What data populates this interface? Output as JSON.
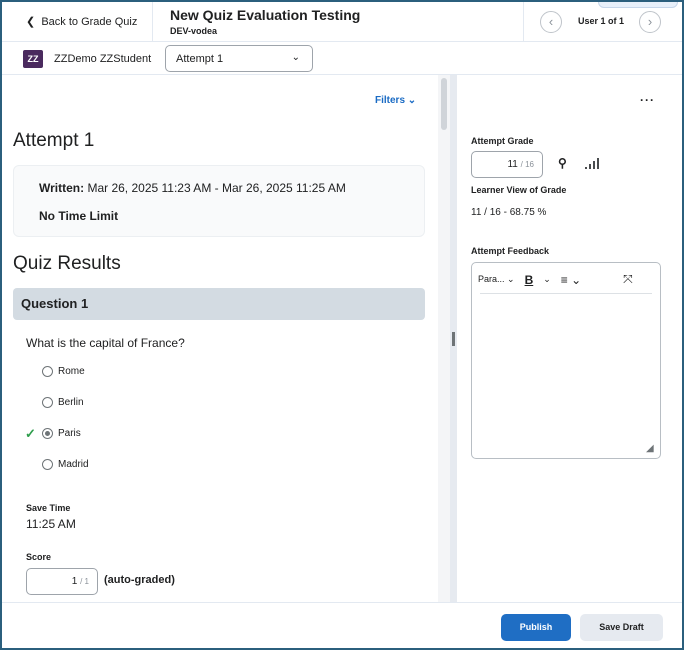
{
  "header": {
    "back_label": "Back to Grade Quiz",
    "title": "New Quiz Evaluation Testing",
    "subtitle": "DEV-vodea",
    "user_counter": "User 1 of 1",
    "prev_icon": "chevron-left",
    "next_icon": "chevron-right"
  },
  "student": {
    "initials": "ZZ",
    "name": "ZZDemo ZZStudent",
    "attempt_select": "Attempt 1"
  },
  "main": {
    "filters_label": "Filters",
    "attempt_heading": "Attempt 1",
    "written_label": "Written:",
    "written_value": "Mar 26, 2025 11:23 AM - Mar 26, 2025 11:25 AM",
    "time_limit": "No Time Limit",
    "results_heading": "Quiz Results",
    "question": {
      "title": "Question 1",
      "text": "What is the capital of France?",
      "options": [
        {
          "label": "Rome",
          "selected": false
        },
        {
          "label": "Berlin",
          "selected": false
        },
        {
          "label": "Paris",
          "selected": true,
          "correct": true
        },
        {
          "label": "Madrid",
          "selected": false
        }
      ]
    },
    "save_time_label": "Save Time",
    "save_time_value": "11:25 AM",
    "score_label": "Score",
    "score_value": "1",
    "score_max": "/ 1",
    "auto_graded": "(auto-graded)"
  },
  "side": {
    "attempt_grade_label": "Attempt Grade",
    "grade_value": "11",
    "grade_max": "/ 16",
    "learner_view_label": "Learner View of Grade",
    "learner_view_value": "11 / 16 - 68.75 %",
    "feedback_label": "Attempt Feedback",
    "toolbar": {
      "paragraph": "Para..."
    }
  },
  "footer": {
    "publish": "Publish",
    "save_draft": "Save Draft"
  },
  "colors": {
    "accent": "#1f6ec4",
    "avatar": "#4a2a5e",
    "correct": "#2e9d4c"
  }
}
